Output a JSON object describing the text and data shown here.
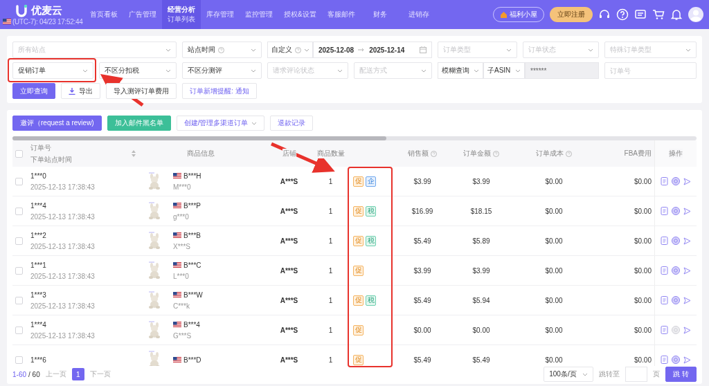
{
  "header": {
    "logo_text": "优麦云",
    "clock": "(UTC-7): 04/23 17:52:44",
    "nav": [
      {
        "label": "首页看板",
        "selected": false
      },
      {
        "label": "广告管理",
        "selected": false
      },
      {
        "label": "经营分析",
        "selected": true,
        "subtitle": "订单列表"
      },
      {
        "label": "库存管理",
        "selected": false
      },
      {
        "label": "监控管理",
        "selected": false
      },
      {
        "label": "授权&设置",
        "selected": false
      },
      {
        "label": "客服邮件",
        "selected": false
      },
      {
        "label": "财务",
        "selected": false
      },
      {
        "label": "进销存",
        "selected": false
      }
    ],
    "welfare_button": "福利小屋",
    "register_button": "立即注册"
  },
  "filters": {
    "fields": [
      {
        "kind": "select",
        "placeholder": "所有站点"
      },
      {
        "kind": "select",
        "value": "站点时间",
        "help": true
      },
      {
        "kind": "daterange",
        "value": "自定义",
        "help": true,
        "start": "2025-12-08",
        "end": "2025-12-14"
      },
      {
        "kind": "select",
        "placeholder": "订单类型"
      },
      {
        "kind": "select",
        "placeholder": "订单状态"
      },
      {
        "kind": "select",
        "placeholder": "特殊订单类型"
      },
      {
        "kind": "select",
        "value": "促销订单"
      },
      {
        "kind": "select",
        "value": "不区分扣税"
      },
      {
        "kind": "select",
        "value": "不区分测评"
      },
      {
        "kind": "select",
        "placeholder": "请求评论状态"
      },
      {
        "kind": "select",
        "placeholder": "配送方式"
      },
      {
        "kind": "search",
        "mode": "模糊查询",
        "field": "子ASIN",
        "value": "******"
      },
      {
        "kind": "input",
        "placeholder": "订单号"
      }
    ],
    "buttons": [
      {
        "label": "立即查询",
        "kind": "primary"
      },
      {
        "label": "导出",
        "kind": "download"
      },
      {
        "label": "导入测评订单费用",
        "kind": "plain"
      },
      {
        "label": "订单新增提醒: 通知",
        "kind": "link"
      }
    ]
  },
  "toolbar": [
    {
      "label": "邀评（request a review)",
      "kind": "primary"
    },
    {
      "label": "加入邮件黑名单",
      "kind": "green"
    },
    {
      "label": "创建/管理多渠道订单",
      "kind": "dropdown"
    },
    {
      "label": "退款记录",
      "kind": "link"
    }
  ],
  "table": {
    "header_checked": false,
    "columns": [
      {
        "label": "订单号",
        "sub": "下单站点时间"
      },
      {
        "label": "商品信息"
      },
      {
        "label": "店铺"
      },
      {
        "label": "商品数量"
      },
      {},
      {
        "label": "销售额",
        "help": true
      },
      {
        "label": "订单金额",
        "help": true
      },
      {
        "label": "订单成本",
        "help": true
      },
      {
        "label": "FBA费用"
      },
      {
        "label": "操作"
      }
    ],
    "rows": [
      {
        "checked": false,
        "order": "1***0",
        "time": "2025-12-13 17:38:43",
        "asin": "B***H",
        "sku": "M***0",
        "store": "A***S",
        "qty": "1",
        "tags": [
          {
            "text": "促",
            "kind": "promo"
          },
          {
            "text": "企",
            "kind": "business"
          }
        ],
        "sales": "$3.99",
        "amount": "$3.99",
        "cost": "$0.00",
        "fba": "$0.00",
        "review_disabled": false
      },
      {
        "checked": false,
        "order": "1***4",
        "time": "2025-12-13 17:38:43",
        "asin": "B***P",
        "sku": "g***0",
        "store": "A***S",
        "qty": "1",
        "tags": [
          {
            "text": "促",
            "kind": "promo"
          },
          {
            "text": "税",
            "kind": "tax"
          }
        ],
        "sales": "$16.99",
        "amount": "$18.15",
        "cost": "$0.00",
        "fba": "$0.00",
        "review_disabled": false
      },
      {
        "checked": false,
        "order": "1***2",
        "time": "2025-12-13 17:38:43",
        "asin": "B***B",
        "sku": "X***S",
        "store": "A***S",
        "qty": "1",
        "tags": [
          {
            "text": "促",
            "kind": "promo"
          },
          {
            "text": "税",
            "kind": "tax"
          }
        ],
        "sales": "$5.49",
        "amount": "$5.89",
        "cost": "$0.00",
        "fba": "$0.00",
        "review_disabled": false
      },
      {
        "checked": false,
        "order": "1***1",
        "time": "2025-12-13 17:38:43",
        "asin": "B***C",
        "sku": "L***0",
        "store": "A***S",
        "qty": "1",
        "tags": [
          {
            "text": "促",
            "kind": "promo"
          }
        ],
        "sales": "$3.99",
        "amount": "$3.99",
        "cost": "$0.00",
        "fba": "$0.00",
        "review_disabled": false
      },
      {
        "checked": false,
        "order": "1***3",
        "time": "2025-12-13 17:38:43",
        "asin": "B***W",
        "sku": "C***k",
        "store": "A***S",
        "qty": "1",
        "tags": [
          {
            "text": "促",
            "kind": "promo"
          },
          {
            "text": "税",
            "kind": "tax"
          }
        ],
        "sales": "$5.49",
        "amount": "$5.94",
        "cost": "$0.00",
        "fba": "$0.00",
        "review_disabled": false
      },
      {
        "checked": false,
        "order": "1***4",
        "time": "2025-12-13 17:38:43",
        "asin": "B***4",
        "sku": "G***S",
        "store": "A***S",
        "qty": "1",
        "tags": [
          {
            "text": "促",
            "kind": "promo"
          }
        ],
        "sales": "$0.00",
        "amount": "$0.00",
        "cost": "$0.00",
        "fba": "$0.00",
        "review_disabled": true
      },
      {
        "checked": false,
        "order": "1***6",
        "asin": "B***D",
        "store": "A***S",
        "qty": "1",
        "tags": [
          {
            "text": "促",
            "kind": "promo"
          }
        ],
        "sales": "$5.49",
        "amount": "$5.49",
        "cost": "$0.00",
        "fba": "$0.00",
        "review_disabled": false
      }
    ]
  },
  "pagination": {
    "range": "1-60",
    "total": "/ 60",
    "prev": "上一页",
    "pages": [
      {
        "label": "1",
        "selected": true
      }
    ],
    "next": "下一页",
    "page_size": "100条/页",
    "jump_label": "跳转至",
    "jump_suffix": "页",
    "jump_button": "跳 转"
  }
}
